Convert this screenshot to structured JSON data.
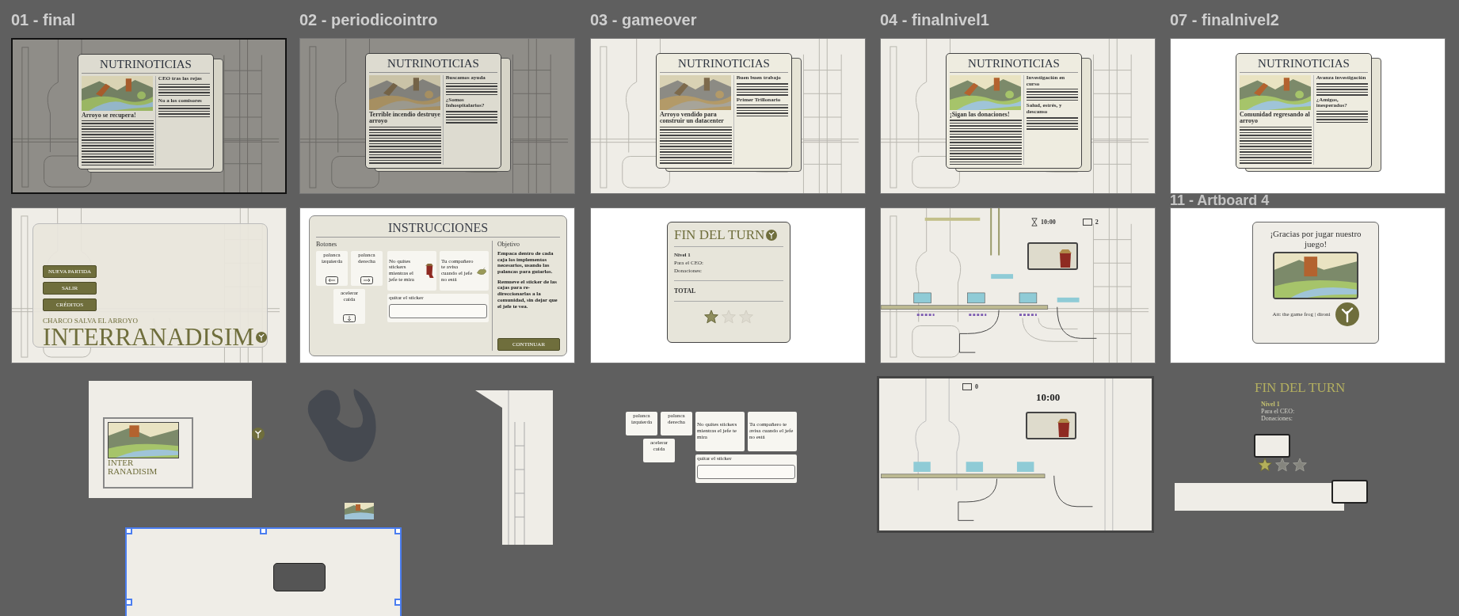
{
  "canvas": {
    "artboards": [
      {
        "kind": "newspaper",
        "title": "01 - final",
        "selected": true,
        "dimmed": true,
        "scene": true,
        "masthead": "NUTRINOTICIAS",
        "headline": "Arroyo se recupera!",
        "side_headlines": [
          "CEO tras las rejas",
          "No a los comisores"
        ]
      },
      {
        "kind": "newspaper",
        "title": "02 - periodicointro",
        "selected": false,
        "dimmed": true,
        "scene": true,
        "masthead": "NUTRINOTICIAS",
        "headline": "Terrible incendio destruye arroyo",
        "side_headlines": [
          "Buscamos ayuda",
          "¿Somos Inhospitalarios?"
        ]
      },
      {
        "kind": "newspaper",
        "title": "03 - gameover",
        "selected": false,
        "dimmed": false,
        "scene": true,
        "masthead": "NUTRINOTICIAS",
        "headline": "Arroyo vendido para construir un datacenter",
        "side_headlines": [
          "Buen buen trabajo",
          "Primer Trillonario"
        ]
      },
      {
        "kind": "newspaper",
        "title": "04 - finalnivel1",
        "selected": false,
        "dimmed": false,
        "scene": true,
        "masthead": "NUTRINOTICIAS",
        "headline": "¡Sigan las donaciones!",
        "side_headlines": [
          "Investigación en curso",
          "Salud, estrés, y descanso"
        ]
      },
      {
        "kind": "newspaper",
        "title": "07 - finalnivel2",
        "selected": false,
        "dimmed": false,
        "scene": false,
        "masthead": "NUTRINOTICIAS",
        "headline": "Comunidad regresando al arroyo",
        "side_headlines": [
          "Avanza investigación",
          "¿Amigos, inesperados?"
        ]
      },
      {
        "kind": "menu",
        "buttons": [
          "NUEVA PARTIDA",
          "SALIR",
          "CRÉDITOS"
        ],
        "subtitle": "CHARCO SALVA EL ARROYO",
        "game_title": "INTERRANADISIM"
      },
      {
        "kind": "instructions",
        "heading": "INSTRUCCIONES",
        "controls_label": "Botones",
        "controls": [
          "palanca izquierda",
          "palanca derecha",
          "acelerar caída"
        ],
        "tips": [
          "No quites stickers mientras el jefe te mira",
          "Tu compañero te avisa cuando el jefe no está"
        ],
        "action": "quitar el sticker",
        "goal_label": "Objetivo",
        "goals": [
          "Empaca dentro de cada caja los implementos necesarios, usando las palancas para guiarlos.",
          "Remueve el sticker de las cajas para re-direccionarlas a la comunidad, sin dejar que el jefe te vea."
        ],
        "continue": "CONTINUAR"
      },
      {
        "kind": "summary",
        "heading": "FIN DEL TURN",
        "level": "Nivel 1",
        "rows": [
          "Para el CEO:",
          "Donaciones:"
        ],
        "total": "TOTAL",
        "stars": 1
      },
      {
        "kind": "game",
        "timer": "10:00",
        "counter": "2"
      },
      {
        "kind": "thanks",
        "title": "11 - Artboard 4",
        "message": "¡Gracias por jugar nuestro juego!",
        "credits": "Att: the game frog | dironi"
      }
    ],
    "scraps": [
      {
        "kind": "title_card",
        "lines": [
          "INTER",
          "RANADISIM"
        ]
      },
      {
        "kind": "logo"
      },
      {
        "kind": "silhouette"
      },
      {
        "kind": "thumbnail"
      },
      {
        "kind": "frame",
        "selected": true
      },
      {
        "kind": "ladder"
      },
      {
        "kind": "instruction_cards",
        "controls": [
          "palanca izquierda",
          "palanca derecha",
          "acelerar caída"
        ],
        "tips": [
          "No quites stickers mientras el jefe te mira",
          "Tu compañero te avisa cuando el jefe no está"
        ],
        "action": "quitar el sticker"
      },
      {
        "kind": "game",
        "counter": "0",
        "timer": "10:00"
      },
      {
        "kind": "summary_draft",
        "heading": "FIN DEL TURN",
        "level": "Nivel 1",
        "rows": [
          "Para el CEO:",
          "Donaciones:"
        ],
        "stars": 1
      }
    ]
  }
}
